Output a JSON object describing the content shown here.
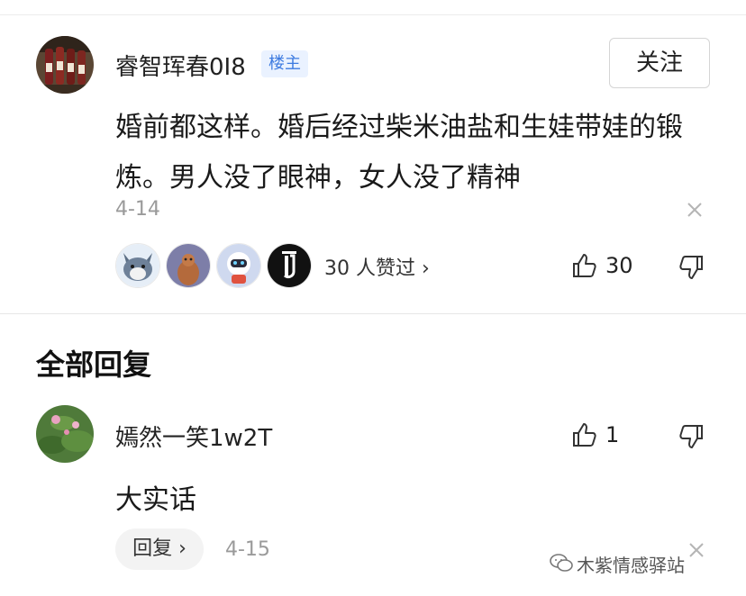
{
  "main_comment": {
    "username": "睿智珲春0I8",
    "badge": "楼主",
    "follow_label": "关注",
    "text": "婚前都这样。婚后经过柴米油盐和生娃带娃的锻炼。男人没了眼神，女人没了精神",
    "date": "4-14",
    "liked_text": "30 人赞过 ›",
    "like_count": "30"
  },
  "replies_section": {
    "title": "全部回复"
  },
  "reply": {
    "username": "嫣然一笑1w2T",
    "text": "大实话",
    "like_count": "1",
    "reply_label": "回复 ›",
    "date": "4-15"
  },
  "watermark": "木紫情感驿站",
  "colors": {
    "badge_bg": "#eaf2ff",
    "badge_text": "#3d7be0",
    "muted_text": "#9a9a9a"
  },
  "icons": [
    "thumb-up-icon",
    "thumb-down-icon",
    "close-icon",
    "wechat-icon"
  ]
}
